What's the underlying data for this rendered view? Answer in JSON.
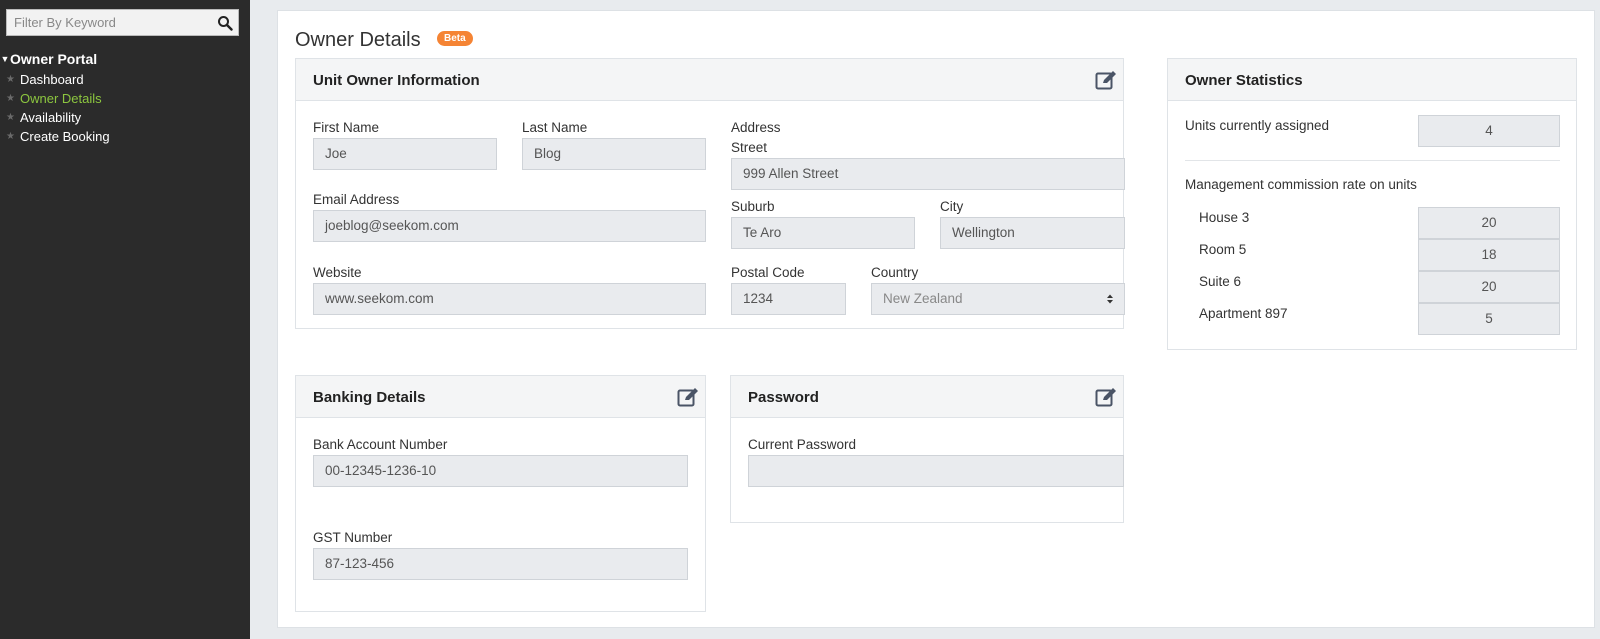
{
  "sidebar": {
    "filter_placeholder": "Filter By Keyword",
    "root_label": "Owner Portal",
    "items": [
      {
        "label": "Dashboard"
      },
      {
        "label": "Owner Details"
      },
      {
        "label": "Availability"
      },
      {
        "label": "Create Booking"
      }
    ],
    "active_item": "Owner Details",
    "active_color": "#8cc63f"
  },
  "page": {
    "title": "Owner Details",
    "badge": "Beta",
    "badge_color": "#f58434"
  },
  "unit_owner": {
    "title": "Unit Owner Information",
    "first_name_label": "First Name",
    "first_name": "Joe",
    "last_name_label": "Last Name",
    "last_name": "Blog",
    "email_label": "Email Address",
    "email": "joeblog@seekom.com",
    "website_label": "Website",
    "website": "www.seekom.com",
    "address_label": "Address",
    "street_label": "Street",
    "street": "999 Allen Street",
    "suburb_label": "Suburb",
    "suburb": "Te Aro",
    "city_label": "City",
    "city": "Wellington",
    "postal_label": "Postal Code",
    "postal": "1234",
    "country_label": "Country",
    "country": "New Zealand"
  },
  "stats": {
    "title": "Owner Statistics",
    "units_label": "Units currently assigned",
    "units_value": "4",
    "commission_label": "Management commission rate on units",
    "rates": [
      {
        "unit": "House 3",
        "rate": "20"
      },
      {
        "unit": "Room 5",
        "rate": "18"
      },
      {
        "unit": "Suite 6",
        "rate": "20"
      },
      {
        "unit": "Apartment 897",
        "rate": "5"
      }
    ]
  },
  "banking": {
    "title": "Banking Details",
    "account_label": "Bank Account Number",
    "account": "00-12345-1236-10",
    "gst_label": "GST Number",
    "gst": "87-123-456"
  },
  "password": {
    "title": "Password",
    "current_label": "Current Password",
    "current": ""
  }
}
